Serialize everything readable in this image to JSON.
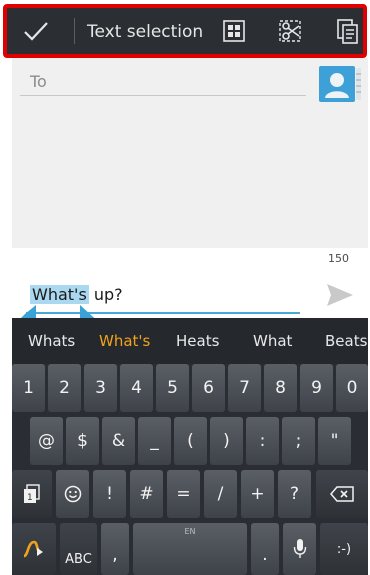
{
  "action_bar": {
    "title": "Text selection",
    "icons": [
      "checkmark-icon",
      "select-all-icon",
      "cut-icon",
      "copy-icon"
    ]
  },
  "compose": {
    "to_placeholder": "To",
    "char_count": "150",
    "message_selected": "What's",
    "message_rest": " up?"
  },
  "suggestions": [
    "Whats",
    "What's",
    "Heats",
    "What",
    "Beats"
  ],
  "keyboard": {
    "row1": [
      "1",
      "2",
      "3",
      "4",
      "5",
      "6",
      "7",
      "8",
      "9",
      "0"
    ],
    "row2": [
      "@",
      "$",
      "&",
      "_",
      "(",
      ")",
      ":",
      ";",
      "\""
    ],
    "row3": [
      "!",
      "#",
      "=",
      "/",
      "+",
      "?"
    ],
    "abc_label": "ABC",
    "comma": ",",
    "period": ".",
    "space_label": "EN",
    "smiley": ":-)"
  },
  "colors": {
    "highlight_border": "#e00000",
    "accent": "#f0a21c",
    "selection": "#a9d8f0"
  }
}
